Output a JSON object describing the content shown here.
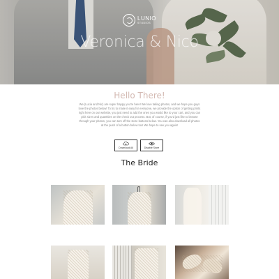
{
  "hero": {
    "logo_name": "LUNIO",
    "logo_sub": "STUDIOS",
    "title": "Veronica & Nico"
  },
  "intro": {
    "heading": "Hello There!",
    "body": "We (Lucia and Nic) are super happy you're here! We love taking photos, and we hope you guys love the photos below! To try to make it easy for everyone, we provide the option of getting prints right here on our website, you just need to add the ones you would like to your cart, and you can pick sizes and quantities on the check out process. But, of course, if you'd just like to browse through your photos, you can turn off the store buttons below. You can also download all photos at the push of a button below too! We hope to see you again!"
  },
  "actions": {
    "download_label": "Download All",
    "download_icon": "cloud-download-icon",
    "store_label": "Disable Store",
    "store_icon": "eye-icon"
  },
  "section": {
    "title": "The Bride"
  },
  "gallery": {
    "photos": [
      {
        "subject": "lace-dress-detail"
      },
      {
        "subject": "dress-on-hanger"
      },
      {
        "subject": "dress-by-window"
      },
      {
        "subject": "dress-bodice"
      },
      {
        "subject": "beaded-dress-back"
      },
      {
        "subject": "bridal-shoes"
      }
    ]
  }
}
